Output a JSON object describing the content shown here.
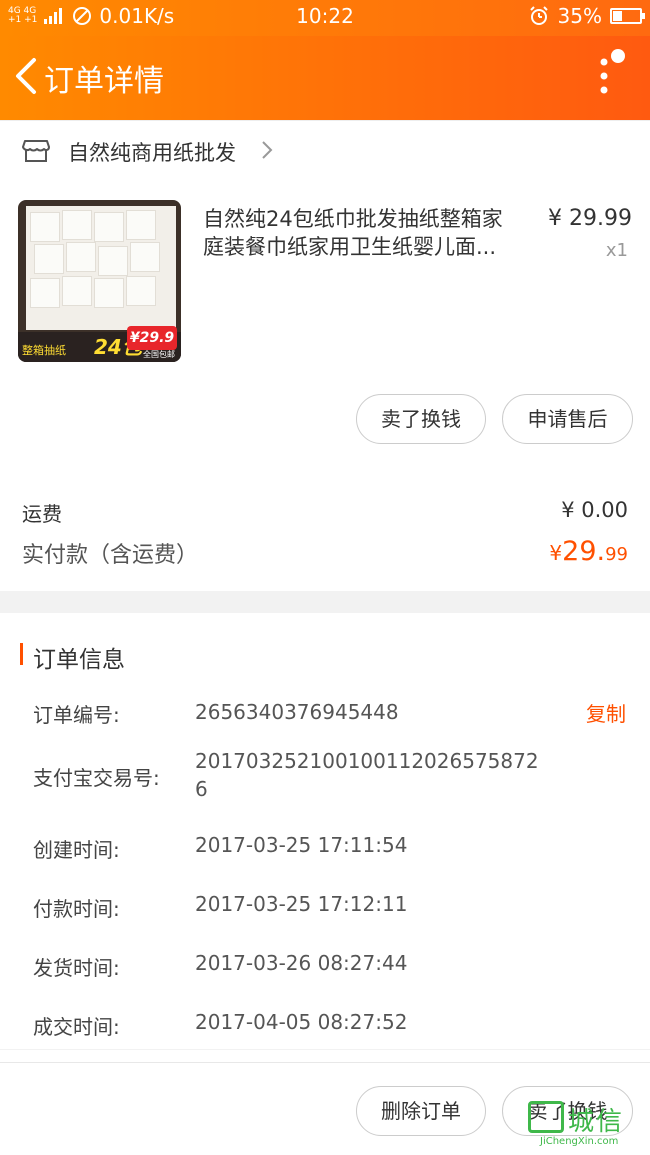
{
  "status_bar": {
    "network_top": "4G 4G",
    "network_bottom": "+1 +1",
    "speed": "0.01K/s",
    "time": "10:22",
    "battery": "35%",
    "battery_level": 0.35
  },
  "header": {
    "title": "订单详情"
  },
  "shop": {
    "name": "自然纯商用纸批发"
  },
  "product": {
    "title": "自然纯24包纸巾批发抽纸整箱家庭装餐巾纸家用卫生纸婴儿面...",
    "title_line1": "自然纯24包纸巾批发抽纸整箱家",
    "title_line2": "庭装餐巾纸家用卫生纸婴儿面...",
    "price": "¥ 29.99",
    "quantity": "x1",
    "thumbnail": {
      "banner_small": "整箱抽纸",
      "banner_big": "24包",
      "price_tag": "¥29.9",
      "free_shipping": "全国包邮"
    }
  },
  "item_actions": {
    "sell": "卖了换钱",
    "after_sale": "申请售后"
  },
  "summary": {
    "shipping_label": "运费",
    "shipping_value": "¥ 0.00",
    "paid_label": "实付款（含运费）",
    "paid_currency": "¥",
    "paid_int": "29.",
    "paid_dec": "99"
  },
  "order_info": {
    "title": "订单信息",
    "copy_label": "复制",
    "rows": [
      {
        "label": "订单编号:",
        "value": "2656340376945448"
      },
      {
        "label": "支付宝交易号:",
        "value": "2017032521001001120265758726"
      },
      {
        "label": "创建时间:",
        "value": "2017-03-25 17:11:54"
      },
      {
        "label": "付款时间:",
        "value": "2017-03-25 17:12:11"
      },
      {
        "label": "发货时间:",
        "value": "2017-03-26 08:27:44"
      },
      {
        "label": "成交时间:",
        "value": "2017-04-05 08:27:52"
      }
    ]
  },
  "bottom_actions": {
    "delete": "删除订单",
    "sell": "卖了换钱"
  },
  "watermark": {
    "text": "城信",
    "domain": "JiChengXin.com"
  },
  "colors": {
    "brand_orange": "#ff6a10",
    "price_orange": "#ff5000",
    "watermark_green": "#3fb84a"
  }
}
